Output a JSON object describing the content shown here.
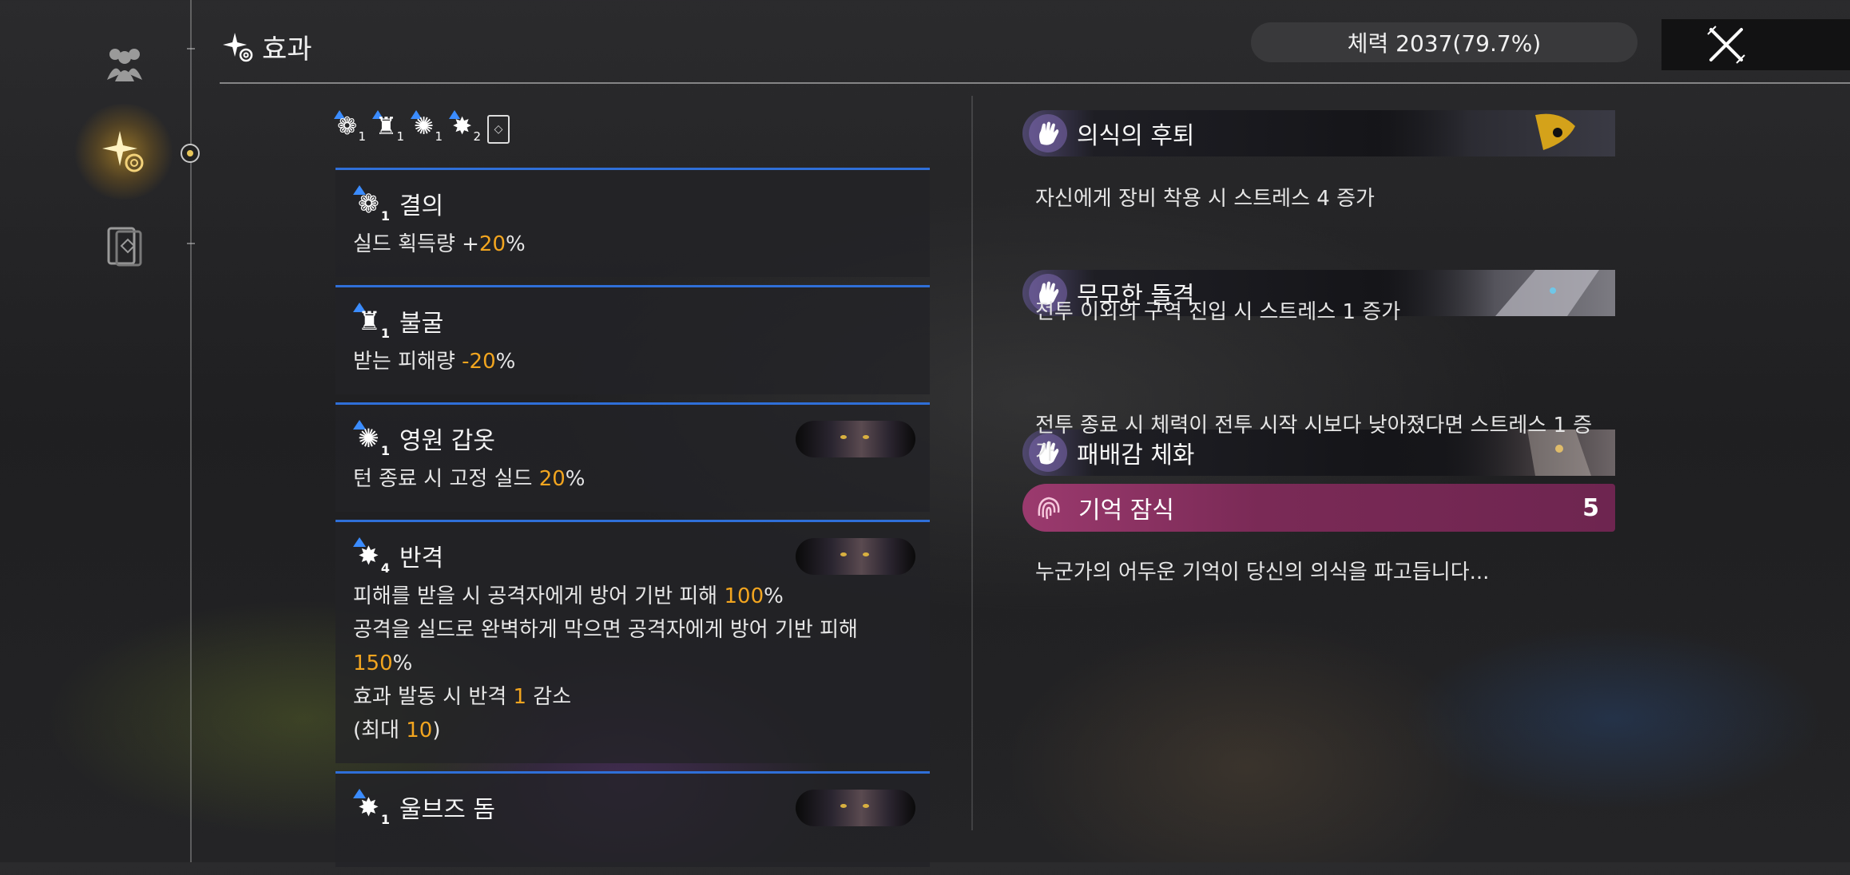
{
  "header": {
    "title": "효과",
    "hp_text": "체력 2037(79.7%)",
    "close_label": "✕"
  },
  "rail": {
    "items": [
      {
        "name": "party",
        "glyph": "♟"
      },
      {
        "name": "effects",
        "glyph": "✦"
      },
      {
        "name": "cards",
        "glyph": "▯"
      }
    ]
  },
  "summary_icons": [
    {
      "glyph": "❁",
      "count": "1"
    },
    {
      "glyph": "♜",
      "count": "1"
    },
    {
      "glyph": "✺",
      "count": "1"
    },
    {
      "glyph": "✸",
      "count": "2"
    }
  ],
  "effects": [
    {
      "name": "결의",
      "count": "1",
      "glyph": "❁",
      "lines": [
        [
          "실드 획득량 +",
          "20",
          "%"
        ]
      ]
    },
    {
      "name": "불굴",
      "count": "1",
      "glyph": "♜",
      "lines": [
        [
          "받는 피해량 ",
          "-20",
          "%"
        ]
      ]
    },
    {
      "name": "영원 갑옷",
      "count": "1",
      "glyph": "✺",
      "lines": [
        [
          "턴 종료 시 고정 실드 ",
          "20",
          "%"
        ]
      ]
    },
    {
      "name": "반격",
      "count": "4",
      "glyph": "✸",
      "lines": [
        [
          "피해를 받을 시 공격자에게 방어 기반 피해 ",
          "100",
          "%"
        ],
        [
          "공격을 실드로 완벽하게 막으면 공격자에게 방어 기반 피해",
          "",
          ""
        ],
        [
          "",
          "150",
          "%"
        ],
        [
          "효과 발동 시 반격 ",
          "1",
          " 감소"
        ],
        [
          "(최대 ",
          "10",
          ")"
        ]
      ]
    },
    {
      "name": "울브즈 돔",
      "count": "1",
      "glyph": "✸",
      "lines": []
    }
  ],
  "stress": [
    {
      "name": "의식의 후퇴",
      "desc": "자신에게 장비 착용 시 스트레스 4 증가"
    },
    {
      "name": "무모한 돌격",
      "desc": "전투 이외의 구역 진입 시 스트레스 1 증가"
    },
    {
      "name": "패배감 체화",
      "desc": "전투 종료 시 체력이 전투 시작 시보다 낮아졌다면 스트레스 1 증가"
    }
  ],
  "memory": {
    "name": "기억 잠식",
    "count": "5",
    "desc": "누군가의 어두운 기억이 당신의 의식을 파고듭니다..."
  },
  "colors": {
    "accent": "#f2a51f",
    "divider_blue": "#2f6fd8",
    "memory": "#9b3a6e"
  }
}
